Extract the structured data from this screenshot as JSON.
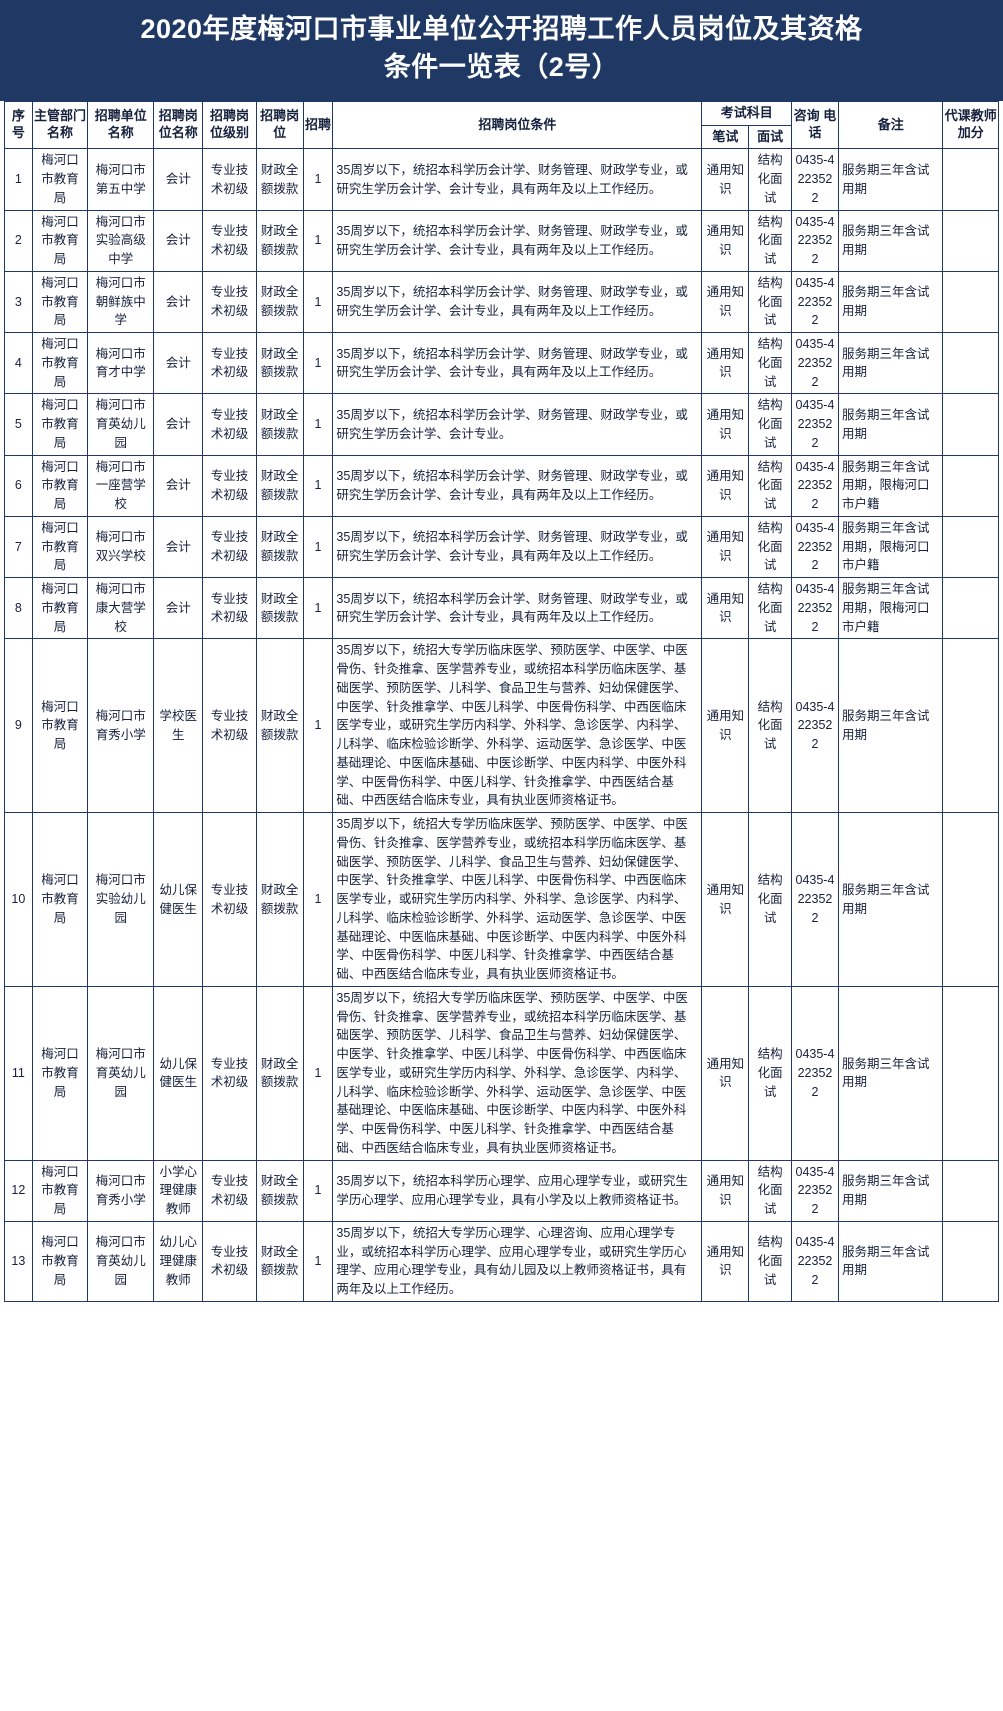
{
  "title": {
    "line1": "2020年度梅河口市事业单位公开招聘工作人员岗位及其资格",
    "line2": "条件一览表（2号）"
  },
  "header": {
    "index": "序号",
    "dept": "主管部门名称",
    "unit": "招聘单位名称",
    "post": "招聘岗位名称",
    "level": "招聘岗位级别",
    "nature": "招聘岗位",
    "count": "招聘",
    "condition": "招聘岗位条件",
    "exam_group": "考试科目",
    "written": "笔试",
    "oral": "面试",
    "phone": "咨询 电话",
    "remark": "备注",
    "bonus": "代课教师加分"
  },
  "common": {
    "dept": "梅河口市教育局",
    "level": "专业技术初级",
    "nature": "财政全额拨款",
    "count": "1",
    "written": "通用知识",
    "oral": "结构化面试",
    "phone": "0435-4223522",
    "remark_basic": "服务期三年含试用期",
    "remark_household": "服务期三年含试用期，限梅河口市户籍",
    "bonus": ""
  },
  "conditions": {
    "accounting_exp": "35周岁以下，统招本科学历会计学、财务管理、财政学专业，或研究生学历会计学、会计专业，具有两年及以上工作经历。",
    "accounting_noexp": "35周岁以下，统招本科学历会计学、财务管理、财政学专业，或研究生学历会计学、会计专业。",
    "medical": "35周岁以下，统招大专学历临床医学、预防医学、中医学、中医骨伤、针灸推拿、医学营养专业，或统招本科学历临床医学、基础医学、预防医学、儿科学、食品卫生与营养、妇幼保健医学、中医学、针灸推拿学、中医儿科学、中医骨伤科学、中西医临床医学专业，或研究生学历内科学、外科学、急诊医学、内科学、儿科学、临床检验诊断学、外科学、运动医学、急诊医学、中医基础理论、中医临床基础、中医诊断学、中医内科学、中医外科学、中医骨伤科学、中医儿科学、针灸推拿学、中西医结合基础、中西医结合临床专业，具有执业医师资格证书。",
    "psych_primary": "35周岁以下，统招本科学历心理学、应用心理学专业，或研究生学历心理学、应用心理学专业，具有小学及以上教师资格证书。",
    "psych_kindergarten": "35周岁以下，统招大专学历心理学、心理咨询、应用心理学专业，或统招本科学历心理学、应用心理学专业，或研究生学历心理学、应用心理学专业，具有幼儿园及以上教师资格证书，具有两年及以上工作经历。"
  },
  "rows": [
    {
      "index": "1",
      "dept": "梅河口市教育局",
      "unit": "梅河口市第五中学",
      "post": "会计",
      "level": "专业技术初级",
      "nature": "财政全额拨款",
      "count": "1",
      "condition": "35周岁以下，统招本科学历会计学、财务管理、财政学专业，或研究生学历会计学、会计专业，具有两年及以上工作经历。",
      "written": "通用知识",
      "oral": "结构化面试",
      "phone": "0435-4223522",
      "remark": "服务期三年含试用期",
      "bonus": ""
    },
    {
      "index": "2",
      "dept": "梅河口市教育局",
      "unit": "梅河口市实验高级中学",
      "post": "会计",
      "level": "专业技术初级",
      "nature": "财政全额拨款",
      "count": "1",
      "condition": "35周岁以下，统招本科学历会计学、财务管理、财政学专业，或研究生学历会计学、会计专业，具有两年及以上工作经历。",
      "written": "通用知识",
      "oral": "结构化面试",
      "phone": "0435-4223522",
      "remark": "服务期三年含试用期",
      "bonus": ""
    },
    {
      "index": "3",
      "dept": "梅河口市教育局",
      "unit": "梅河口市朝鲜族中学",
      "post": "会计",
      "level": "专业技术初级",
      "nature": "财政全额拨款",
      "count": "1",
      "condition": "35周岁以下，统招本科学历会计学、财务管理、财政学专业，或研究生学历会计学、会计专业，具有两年及以上工作经历。",
      "written": "通用知识",
      "oral": "结构化面试",
      "phone": "0435-4223522",
      "remark": "服务期三年含试用期",
      "bonus": ""
    },
    {
      "index": "4",
      "dept": "梅河口市教育局",
      "unit": "梅河口市育才中学",
      "post": "会计",
      "level": "专业技术初级",
      "nature": "财政全额拨款",
      "count": "1",
      "condition": "35周岁以下，统招本科学历会计学、财务管理、财政学专业，或研究生学历会计学、会计专业，具有两年及以上工作经历。",
      "written": "通用知识",
      "oral": "结构化面试",
      "phone": "0435-4223522",
      "remark": "服务期三年含试用期",
      "bonus": ""
    },
    {
      "index": "5",
      "dept": "梅河口市教育局",
      "unit": "梅河口市育英幼儿园",
      "post": "会计",
      "level": "专业技术初级",
      "nature": "财政全额拨款",
      "count": "1",
      "condition": "35周岁以下，统招本科学历会计学、财务管理、财政学专业，或研究生学历会计学、会计专业。",
      "written": "通用知识",
      "oral": "结构化面试",
      "phone": "0435-4223522",
      "remark": "服务期三年含试用期",
      "bonus": ""
    },
    {
      "index": "6",
      "dept": "梅河口市教育局",
      "unit": "梅河口市一座营学校",
      "post": "会计",
      "level": "专业技术初级",
      "nature": "财政全额拨款",
      "count": "1",
      "condition": "35周岁以下，统招本科学历会计学、财务管理、财政学专业，或研究生学历会计学、会计专业，具有两年及以上工作经历。",
      "written": "通用知识",
      "oral": "结构化面试",
      "phone": "0435-4223522",
      "remark": "服务期三年含试用期，限梅河口市户籍",
      "bonus": ""
    },
    {
      "index": "7",
      "dept": "梅河口市教育局",
      "unit": "梅河口市双兴学校",
      "post": "会计",
      "level": "专业技术初级",
      "nature": "财政全额拨款",
      "count": "1",
      "condition": "35周岁以下，统招本科学历会计学、财务管理、财政学专业，或研究生学历会计学、会计专业，具有两年及以上工作经历。",
      "written": "通用知识",
      "oral": "结构化面试",
      "phone": "0435-4223522",
      "remark": "服务期三年含试用期，限梅河口市户籍",
      "bonus": ""
    },
    {
      "index": "8",
      "dept": "梅河口市教育局",
      "unit": "梅河口市康大营学校",
      "post": "会计",
      "level": "专业技术初级",
      "nature": "财政全额拨款",
      "count": "1",
      "condition": "35周岁以下，统招本科学历会计学、财务管理、财政学专业，或研究生学历会计学、会计专业，具有两年及以上工作经历。",
      "written": "通用知识",
      "oral": "结构化面试",
      "phone": "0435-4223522",
      "remark": "服务期三年含试用期，限梅河口市户籍",
      "bonus": ""
    },
    {
      "index": "9",
      "dept": "梅河口市教育局",
      "unit": "梅河口市育秀小学",
      "post": "学校医生",
      "level": "专业技术初级",
      "nature": "财政全额拨款",
      "count": "1",
      "condition": "35周岁以下，统招大专学历临床医学、预防医学、中医学、中医骨伤、针灸推拿、医学营养专业，或统招本科学历临床医学、基础医学、预防医学、儿科学、食品卫生与营养、妇幼保健医学、中医学、针灸推拿学、中医儿科学、中医骨伤科学、中西医临床医学专业，或研究生学历内科学、外科学、急诊医学、内科学、儿科学、临床检验诊断学、外科学、运动医学、急诊医学、中医基础理论、中医临床基础、中医诊断学、中医内科学、中医外科学、中医骨伤科学、中医儿科学、针灸推拿学、中西医结合基础、中西医结合临床专业，具有执业医师资格证书。",
      "written": "通用知识",
      "oral": "结构化面试",
      "phone": "0435-4223522",
      "remark": "服务期三年含试用期",
      "bonus": ""
    },
    {
      "index": "10",
      "dept": "梅河口市教育局",
      "unit": "梅河口市实验幼儿园",
      "post": "幼儿保健医生",
      "level": "专业技术初级",
      "nature": "财政全额拨款",
      "count": "1",
      "condition": "35周岁以下，统招大专学历临床医学、预防医学、中医学、中医骨伤、针灸推拿、医学营养专业，或统招本科学历临床医学、基础医学、预防医学、儿科学、食品卫生与营养、妇幼保健医学、中医学、针灸推拿学、中医儿科学、中医骨伤科学、中西医临床医学专业，或研究生学历内科学、外科学、急诊医学、内科学、儿科学、临床检验诊断学、外科学、运动医学、急诊医学、中医基础理论、中医临床基础、中医诊断学、中医内科学、中医外科学、中医骨伤科学、中医儿科学、针灸推拿学、中西医结合基础、中西医结合临床专业，具有执业医师资格证书。",
      "written": "通用知识",
      "oral": "结构化面试",
      "phone": "0435-4223522",
      "remark": "服务期三年含试用期",
      "bonus": ""
    },
    {
      "index": "11",
      "dept": "梅河口市教育局",
      "unit": "梅河口市育英幼儿园",
      "post": "幼儿保健医生",
      "level": "专业技术初级",
      "nature": "财政全额拨款",
      "count": "1",
      "condition": "35周岁以下，统招大专学历临床医学、预防医学、中医学、中医骨伤、针灸推拿、医学营养专业，或统招本科学历临床医学、基础医学、预防医学、儿科学、食品卫生与营养、妇幼保健医学、中医学、针灸推拿学、中医儿科学、中医骨伤科学、中西医临床医学专业，或研究生学历内科学、外科学、急诊医学、内科学、儿科学、临床检验诊断学、外科学、运动医学、急诊医学、中医基础理论、中医临床基础、中医诊断学、中医内科学、中医外科学、中医骨伤科学、中医儿科学、针灸推拿学、中西医结合基础、中西医结合临床专业，具有执业医师资格证书。",
      "written": "通用知识",
      "oral": "结构化面试",
      "phone": "0435-4223522",
      "remark": "服务期三年含试用期",
      "bonus": ""
    },
    {
      "index": "12",
      "dept": "梅河口市教育局",
      "unit": "梅河口市育秀小学",
      "post": "小学心理健康教师",
      "level": "专业技术初级",
      "nature": "财政全额拨款",
      "count": "1",
      "condition": "35周岁以下，统招本科学历心理学、应用心理学专业，或研究生学历心理学、应用心理学专业，具有小学及以上教师资格证书。",
      "written": "通用知识",
      "oral": "结构化面试",
      "phone": "0435-4223522",
      "remark": "服务期三年含试用期",
      "bonus": ""
    },
    {
      "index": "13",
      "dept": "梅河口市教育局",
      "unit": "梅河口市育英幼儿园",
      "post": "幼儿心理健康教师",
      "level": "专业技术初级",
      "nature": "财政全额拨款",
      "count": "1",
      "condition": "35周岁以下，统招大专学历心理学、心理咨询、应用心理学专业，或统招本科学历心理学、应用心理学专业，或研究生学历心理学、应用心理学专业，具有幼儿园及以上教师资格证书，具有两年及以上工作经历。",
      "written": "通用知识",
      "oral": "结构化面试",
      "phone": "0435-4223522",
      "remark": "服务期三年含试用期",
      "bonus": ""
    }
  ]
}
